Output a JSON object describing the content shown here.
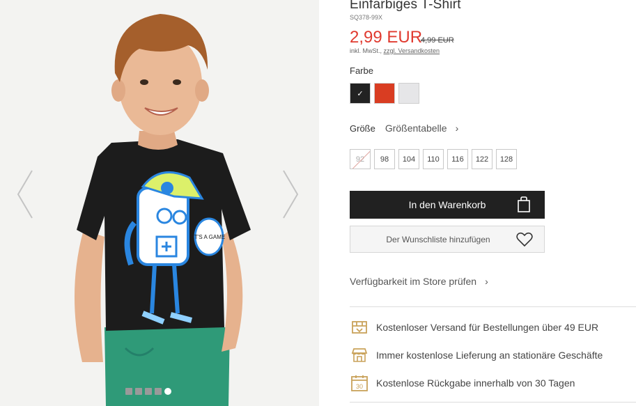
{
  "product": {
    "title": "Einfarbiges T-Shirt",
    "sku": "SQ378-99X",
    "price": "2,99 EUR",
    "old_price": "4,99 EUR",
    "vat_note": "inkl. MwSt., ",
    "shipping_link": "zzgl. Versandkosten"
  },
  "colors": {
    "label": "Farbe",
    "options": [
      {
        "name": "schwarz",
        "hex": "#222222",
        "selected": true,
        "check": "✓"
      },
      {
        "name": "rot",
        "hex": "#d93d22",
        "selected": false,
        "check": ""
      },
      {
        "name": "grau",
        "hex": "#e6e6e8",
        "selected": false,
        "check": ""
      }
    ]
  },
  "sizes": {
    "label": "Größe",
    "chart_link": "Größentabelle",
    "chart_chevron": "›",
    "options": [
      {
        "label": "92",
        "available": false
      },
      {
        "label": "98",
        "available": true
      },
      {
        "label": "104",
        "available": true
      },
      {
        "label": "110",
        "available": true
      },
      {
        "label": "116",
        "available": true
      },
      {
        "label": "122",
        "available": true
      },
      {
        "label": "128",
        "available": true
      }
    ]
  },
  "actions": {
    "add_to_cart": "In den Warenkorb",
    "add_to_wishlist": "Der Wunschliste hinzufügen",
    "store_availability": "Verfügbarkeit im Store prüfen",
    "store_chevron": "›"
  },
  "benefits": [
    {
      "icon": "shipping-box-icon",
      "text": "Kostenloser Versand für Bestellungen über 49 EUR"
    },
    {
      "icon": "store-icon",
      "text": "Immer kostenlose Lieferung an stationäre Geschäfte"
    },
    {
      "icon": "calendar-30-icon",
      "text": "Kostenlose Rückgabe innerhalb von 30 Tagen",
      "badge": "30"
    }
  ],
  "gallery": {
    "images_count": 5,
    "active_index": 4,
    "print_text": "IT'S A GAME"
  },
  "colors_theme": {
    "price_red": "#e03a2f",
    "cart_button": "#212121",
    "benefit_icon": "#c9a25a"
  }
}
